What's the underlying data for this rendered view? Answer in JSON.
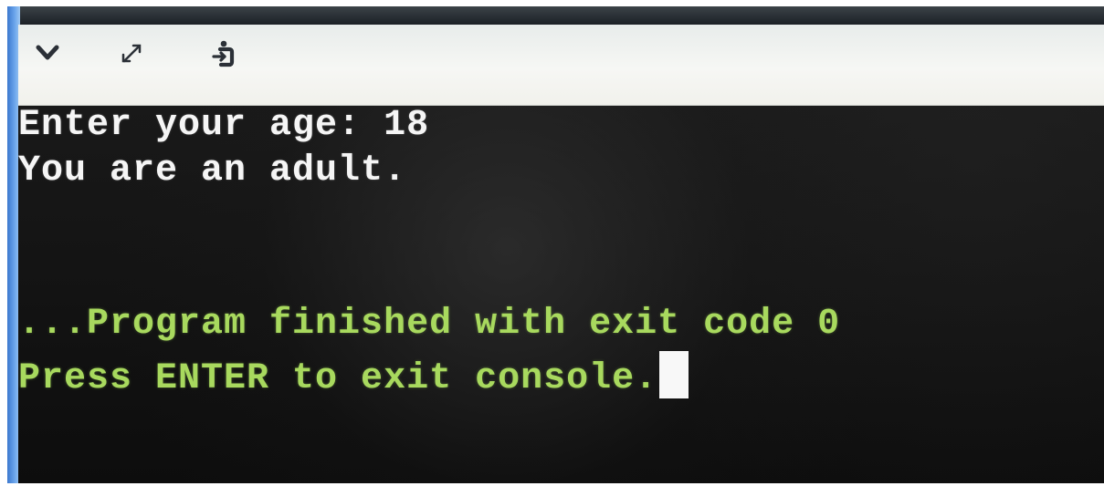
{
  "toolbar": {
    "icons": [
      "chevron-down-icon",
      "expand-icon",
      "stop-icon"
    ]
  },
  "console": {
    "lines": [
      {
        "text": "Enter your age: 18",
        "color": "#f5f5f5"
      },
      {
        "text": "You are an adult.",
        "color": "#f5f5f5"
      },
      {
        "text": "...Program finished with exit code 0",
        "color": "#a8d95e"
      },
      {
        "text": "Press ENTER to exit console.",
        "color": "#a8d95e"
      }
    ]
  },
  "colors": {
    "console_background": "#141414",
    "toolbar_background": "#f4f5f2",
    "output_text": "#f5f5f5",
    "status_text": "#a8d95e",
    "cursor": "#f8f8f8"
  }
}
